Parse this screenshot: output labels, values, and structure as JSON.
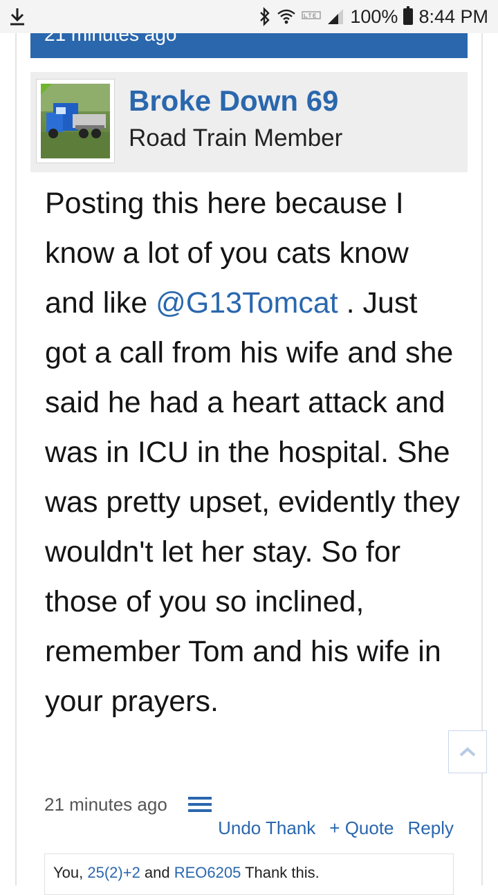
{
  "status_bar": {
    "battery": "100%",
    "time": "8:44 PM",
    "icons": [
      "download-icon",
      "bluetooth-icon",
      "wifi-icon",
      "lte-icon",
      "signal-icon",
      "battery-icon"
    ]
  },
  "previous_post": {
    "timestamp": "21 minutes ago"
  },
  "post": {
    "author": {
      "name": "Broke Down 69",
      "title": "Road Train Member"
    },
    "body": {
      "part1": "Posting this here because I know a lot of you cats know and like ",
      "mention": "@G13Tomcat",
      "part2": " . Just got a call from his wife and she said he had a heart attack and was in ICU in the hospital. She was pretty upset, evidently they wouldn't let her stay. So for those of you so inclined, remember Tom and his wife in your prayers."
    },
    "timestamp": "21 minutes ago",
    "actions": {
      "undo_thank": "Undo Thank",
      "quote": "+ Quote",
      "reply": "Reply"
    },
    "likes": {
      "prefix": "You, ",
      "user1": "25(2)+2",
      "and": " and ",
      "user2": "REO6205",
      "suffix": " Thank this."
    }
  },
  "colors": {
    "accent": "#2a67ad",
    "header_bg": "#eeeeee",
    "status_bar_bg": "#f4f4f4"
  }
}
